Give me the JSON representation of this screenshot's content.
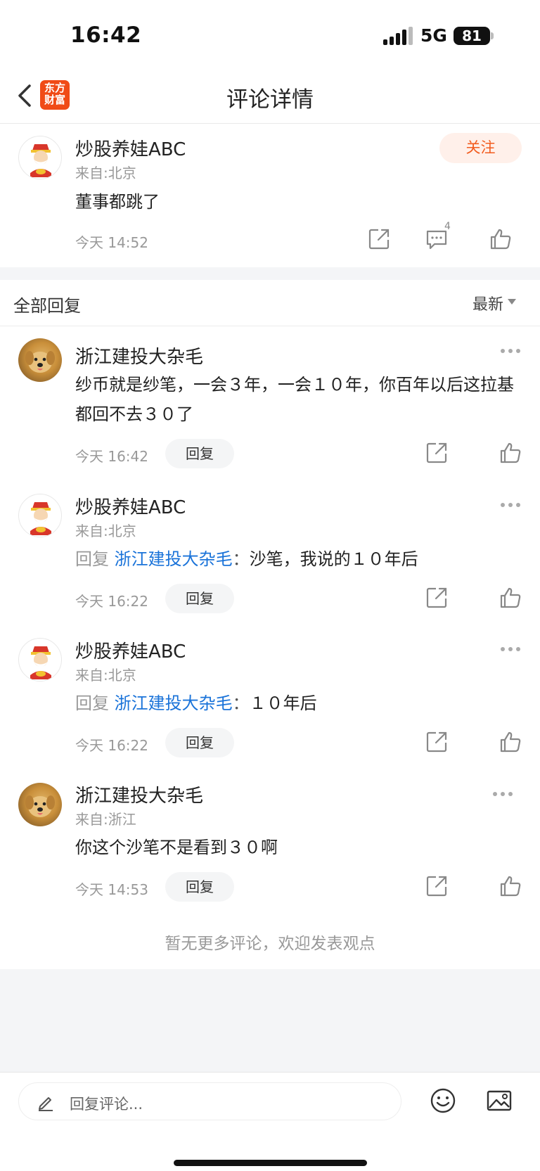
{
  "status_bar": {
    "time": "16:42",
    "network": "5G",
    "battery": "81"
  },
  "nav": {
    "title": "评论详情",
    "logo_text": "东方财富"
  },
  "main_comment": {
    "user": "炒股养娃ABC",
    "from": "来自:北京",
    "content": "董事都跳了",
    "time": "今天 14:52",
    "follow_label": "关注",
    "comment_count": "4"
  },
  "replies_section": {
    "title": "全部回复",
    "sort_label": "最新"
  },
  "replies": [
    {
      "user": "浙江建投大杂毛",
      "from": "",
      "reply_prefix": "",
      "mention": "",
      "sep": "",
      "text": "纱币就是纱笔，一会３年，一会１０年，你百年以后这拉基都回不去３０了",
      "time": "今天 16:42",
      "reply_label": "回复"
    },
    {
      "user": "炒股养娃ABC",
      "from": "来自:北京",
      "reply_prefix": "回复",
      "mention": "浙江建投大杂毛",
      "sep": "：",
      "text": "沙笔，我说的１０年后",
      "time": "今天 16:22",
      "reply_label": "回复"
    },
    {
      "user": "炒股养娃ABC",
      "from": "来自:北京",
      "reply_prefix": "回复",
      "mention": "浙江建投大杂毛",
      "sep": "：",
      "text": "１０年后",
      "time": "今天 16:22",
      "reply_label": "回复"
    },
    {
      "user": "浙江建投大杂毛",
      "from": "来自:浙江",
      "reply_prefix": "",
      "mention": "",
      "sep": "",
      "text": "你这个沙笔不是看到３０啊",
      "time": "今天 14:53",
      "reply_label": "回复"
    }
  ],
  "footer_note": "暂无更多评论，欢迎发表观点",
  "bottom_bar": {
    "input_placeholder": "回复评论..."
  },
  "colors": {
    "accent": "#f25c1f",
    "link": "#1a73d9",
    "logo": "#f04b17"
  }
}
